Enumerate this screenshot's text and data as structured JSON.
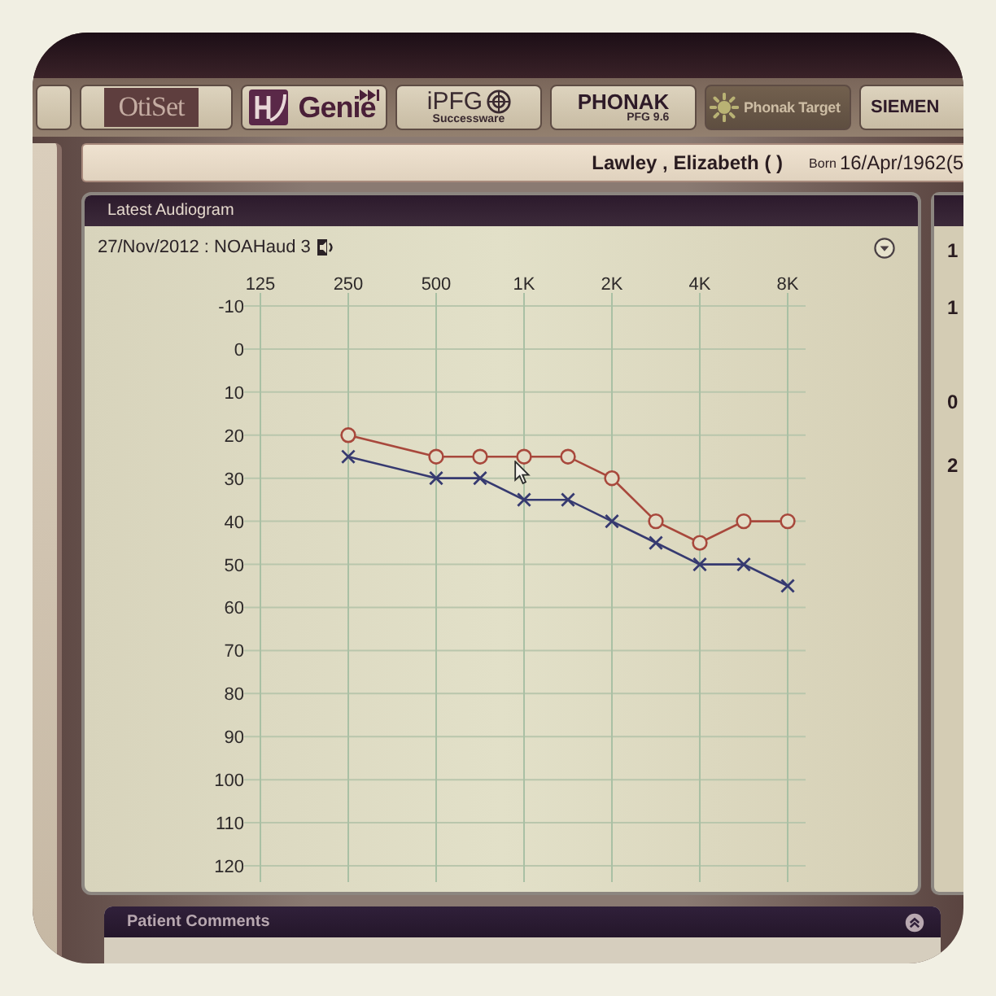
{
  "toolbar": {
    "tabs": [
      {
        "kind": "boxed",
        "label": "OtiSet"
      },
      {
        "kind": "genie",
        "label": "Genie"
      },
      {
        "kind": "ipfg",
        "label": "iPFG",
        "sublabel": "Successware"
      },
      {
        "kind": "phonak",
        "label": "PHONAK",
        "sublabel": "PFG 9.6"
      },
      {
        "kind": "target",
        "label": "Phonak Target"
      },
      {
        "kind": "plain",
        "label": "SIEMEN"
      }
    ]
  },
  "header": {
    "patient_name": "Lawley , Elizabeth ( )",
    "born_label": "Born",
    "born_date": "16/Apr/1962(5"
  },
  "audiogram_panel": {
    "title": "Latest Audiogram",
    "test_label": "27/Nov/2012 : NOAHaud 3",
    "chart_data": {
      "type": "line",
      "grid": true,
      "categories": [
        "125",
        null,
        "250",
        null,
        "500",
        null,
        "1K",
        null,
        "2K",
        null,
        "4K",
        null,
        "8K"
      ],
      "ylim": [
        120,
        -10
      ],
      "yticks": [
        -10,
        0,
        10,
        20,
        30,
        40,
        50,
        60,
        70,
        80,
        90,
        100,
        110,
        120
      ],
      "series": [
        {
          "color": "#a8483c",
          "marker": "circle",
          "values": [
            null,
            null,
            20,
            null,
            25,
            25,
            25,
            25,
            30,
            40,
            45,
            40,
            40
          ]
        },
        {
          "color": "#363a70",
          "marker": "cross",
          "values": [
            null,
            null,
            25,
            null,
            30,
            30,
            35,
            35,
            40,
            45,
            50,
            50,
            55
          ]
        }
      ]
    }
  },
  "side_panel": {
    "values": [
      "1",
      "1",
      "0",
      "2"
    ]
  },
  "comments_panel": {
    "title": "Patient Comments"
  }
}
